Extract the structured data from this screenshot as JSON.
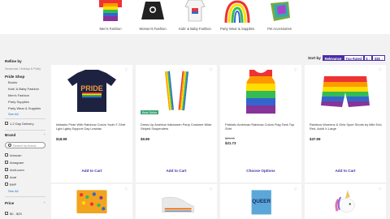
{
  "categories": [
    {
      "label": "Men's Fashion",
      "icon": "rainbow-shirt-icon"
    },
    {
      "label": "Women's Fashion",
      "icon": "black-hoodie-icon"
    },
    {
      "label": "Kids' & Baby Fashion",
      "icon": "baby-bodysuit-icon"
    },
    {
      "label": "Party Wear & Supplies",
      "icon": "rainbow-balloon-arch-icon"
    },
    {
      "label": "Pet Accessories",
      "icon": "pet-sequin-cape-icon"
    }
  ],
  "filters": {
    "refine_title": "Refine by",
    "refine_sub": "Seasonal, Holiday & Party",
    "pride_title": "Pride Shop",
    "pride_items": [
      "Books",
      "Kids' & Baby Fashion",
      "Men's Fashion",
      "Party Supplies",
      "Party Wear & Supplies"
    ],
    "see_all": "See All",
    "delivery_label": "1-2 Day Delivery",
    "brand_title": "Brand",
    "brand_search_placeholder": "Search by brand...",
    "brands": [
      "Amscan",
      "Amagram",
      "AmiLuxen",
      "Anal",
      "BHP"
    ],
    "brand_see_all": "See All",
    "price_title": "Price",
    "price_range": "$0 - $25"
  },
  "sort": {
    "label": "Sort by",
    "options": [
      {
        "label": "Relevance",
        "active": true
      },
      {
        "label": "Top Rated",
        "active": false
      },
      {
        "label": "$ ↓",
        "active": false
      },
      {
        "label": "$$$ ↓",
        "active": false
      }
    ]
  },
  "products": [
    {
      "title": "Inktastic Pride With Rainbow Colors Youth T-Shirt Lgbt Lgbtq Support Gay Lesbian",
      "price": "$18.99",
      "button": "Add to Cart",
      "image": "navy-pride-tshirt"
    },
    {
      "title": "Dress Up America Halloween Party Costume Wide Striped Suspenders",
      "price": "$9.99",
      "button": "Add to Cart",
      "badge": "Best Seller",
      "image": "rainbow-suspenders"
    },
    {
      "title": "Patriotic American Rainbow Colors Flag Tank Top Shirt",
      "old_price": "$25.99",
      "price": "$21.73",
      "button": "Choose Options",
      "image": "rainbow-tank-top"
    },
    {
      "title": "Rainbow Womens & Girls Sport Shorts by Mile End, Red, Adult X-Large",
      "price": "$37.99",
      "button": "Add to Cart",
      "image": "rainbow-shorts"
    }
  ],
  "bottom_products": [
    {
      "image": "rainbow-candy-pack"
    },
    {
      "image": "rainbow-sneakers"
    },
    {
      "image": "queer-book-cover",
      "cover_text": "QUEER"
    },
    {
      "image": "unicorn-head-decor"
    }
  ],
  "colors": {
    "accent": "#4b2ea8",
    "badge": "#3aa573",
    "link": "#1a6ecc"
  }
}
